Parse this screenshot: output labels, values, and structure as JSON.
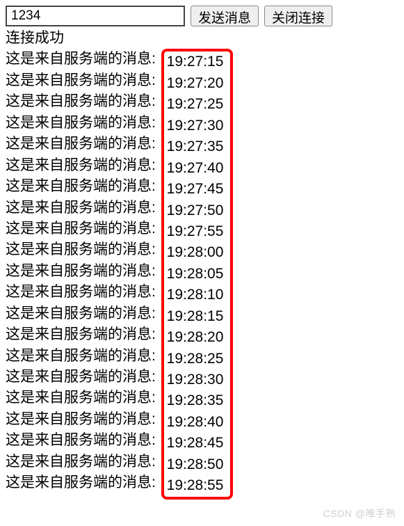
{
  "toolbar": {
    "input_value": "1234",
    "send_label": "发送消息",
    "close_label": "关闭连接"
  },
  "log": {
    "status": "连接成功",
    "message_prefix": "这是来自服务端的消息: ",
    "messages": [
      {
        "time": "19:27:15"
      },
      {
        "time": "19:27:20"
      },
      {
        "time": "19:27:25"
      },
      {
        "time": "19:27:30"
      },
      {
        "time": "19:27:35"
      },
      {
        "time": "19:27:40"
      },
      {
        "time": "19:27:45"
      },
      {
        "time": "19:27:50"
      },
      {
        "time": "19:27:55"
      },
      {
        "time": "19:28:00"
      },
      {
        "time": "19:28:05"
      },
      {
        "time": "19:28:10"
      },
      {
        "time": "19:28:15"
      },
      {
        "time": "19:28:20"
      },
      {
        "time": "19:28:25"
      },
      {
        "time": "19:28:30"
      },
      {
        "time": "19:28:35"
      },
      {
        "time": "19:28:40"
      },
      {
        "time": "19:28:45"
      },
      {
        "time": "19:28:50"
      },
      {
        "time": "19:28:55"
      }
    ]
  },
  "watermark": {
    "text": "CSDN @唯手熟"
  }
}
